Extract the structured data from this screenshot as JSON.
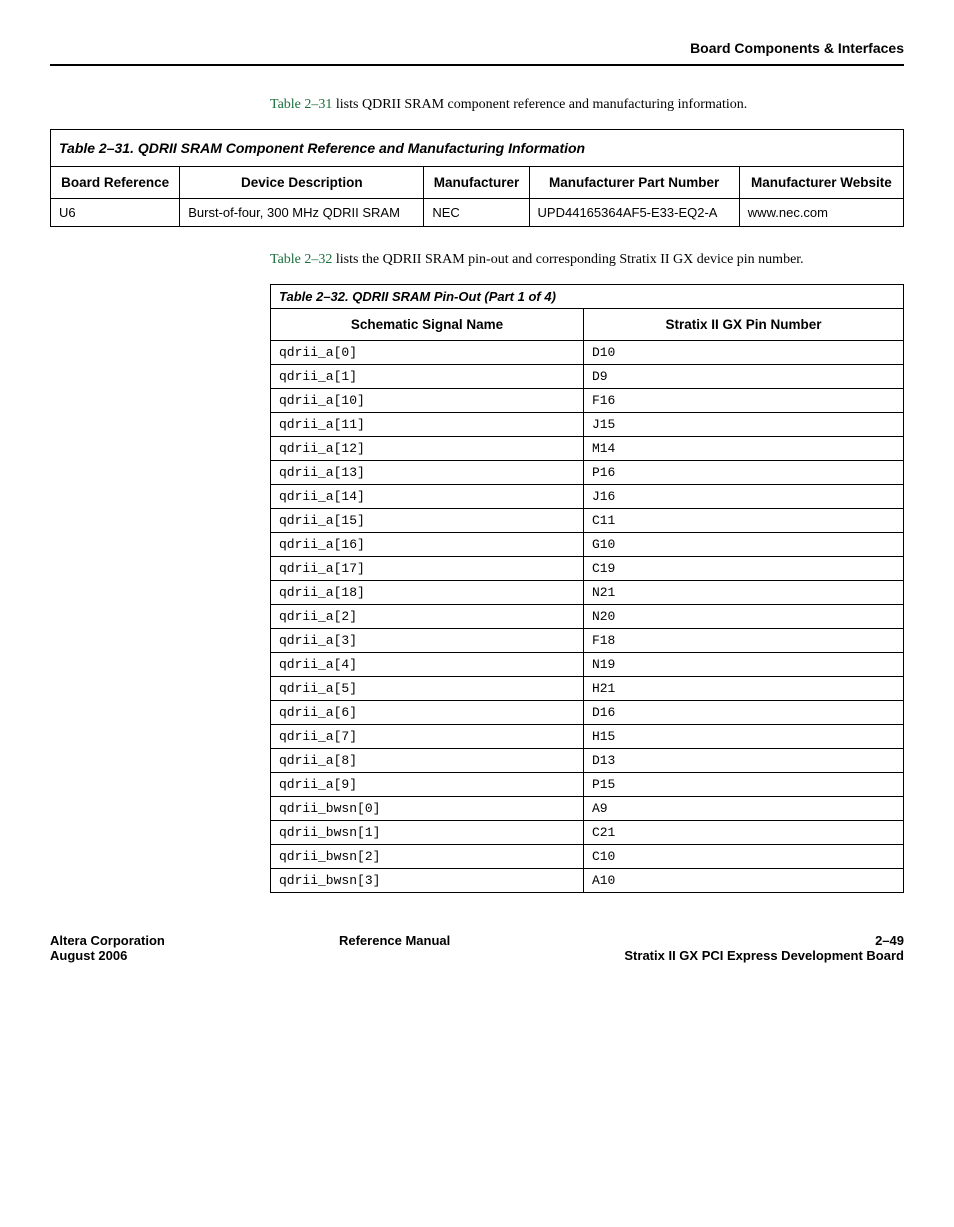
{
  "header": {
    "section_title": "Board Components & Interfaces"
  },
  "intro1": {
    "link": "Table 2–31",
    "text_rest": " lists QDRII SRAM component reference and manufacturing information."
  },
  "table1": {
    "caption": "Table 2–31. QDRII SRAM Component Reference and Manufacturing Information",
    "headers": {
      "c1": "Board Reference",
      "c2": "Device Description",
      "c3": "Manufacturer",
      "c4": "Manufacturer Part Number",
      "c5": "Manufacturer Website"
    },
    "rows": [
      {
        "c1": "U6",
        "c2": "Burst-of-four, 300 MHz QDRII SRAM",
        "c3": "NEC",
        "c4": "UPD44165364AF5-E33-EQ2-A",
        "c5": "www.nec.com"
      }
    ]
  },
  "intro2": {
    "link": "Table 2–32",
    "text_rest": " lists the QDRII SRAM pin-out and corresponding Stratix II GX device pin number."
  },
  "table2": {
    "caption": "Table 2–32. QDRII SRAM Pin-Out  (Part 1 of 4)",
    "headers": {
      "c1": "Schematic Signal Name",
      "c2": "Stratix II GX Pin Number"
    },
    "rows": [
      {
        "c1": "qdrii_a[0]",
        "c2": "D10"
      },
      {
        "c1": "qdrii_a[1]",
        "c2": "D9"
      },
      {
        "c1": "qdrii_a[10]",
        "c2": "F16"
      },
      {
        "c1": "qdrii_a[11]",
        "c2": "J15"
      },
      {
        "c1": "qdrii_a[12]",
        "c2": "M14"
      },
      {
        "c1": "qdrii_a[13]",
        "c2": "P16"
      },
      {
        "c1": "qdrii_a[14]",
        "c2": "J16"
      },
      {
        "c1": "qdrii_a[15]",
        "c2": "C11"
      },
      {
        "c1": "qdrii_a[16]",
        "c2": "G10"
      },
      {
        "c1": "qdrii_a[17]",
        "c2": "C19"
      },
      {
        "c1": "qdrii_a[18]",
        "c2": "N21"
      },
      {
        "c1": "qdrii_a[2]",
        "c2": "N20"
      },
      {
        "c1": "qdrii_a[3]",
        "c2": "F18"
      },
      {
        "c1": "qdrii_a[4]",
        "c2": "N19"
      },
      {
        "c1": "qdrii_a[5]",
        "c2": "H21"
      },
      {
        "c1": "qdrii_a[6]",
        "c2": "D16"
      },
      {
        "c1": "qdrii_a[7]",
        "c2": "H15"
      },
      {
        "c1": "qdrii_a[8]",
        "c2": "D13"
      },
      {
        "c1": "qdrii_a[9]",
        "c2": "P15"
      },
      {
        "c1": "qdrii_bwsn[0]",
        "c2": "A9"
      },
      {
        "c1": "qdrii_bwsn[1]",
        "c2": "C21"
      },
      {
        "c1": "qdrii_bwsn[2]",
        "c2": "C10"
      },
      {
        "c1": "qdrii_bwsn[3]",
        "c2": "A10"
      }
    ]
  },
  "footer": {
    "left_line1": "Altera Corporation",
    "left_line2": "August 2006",
    "center_line1": "Reference Manual",
    "right_line1": "2–49",
    "right_line2": "Stratix II GX PCI Express Development Board"
  }
}
